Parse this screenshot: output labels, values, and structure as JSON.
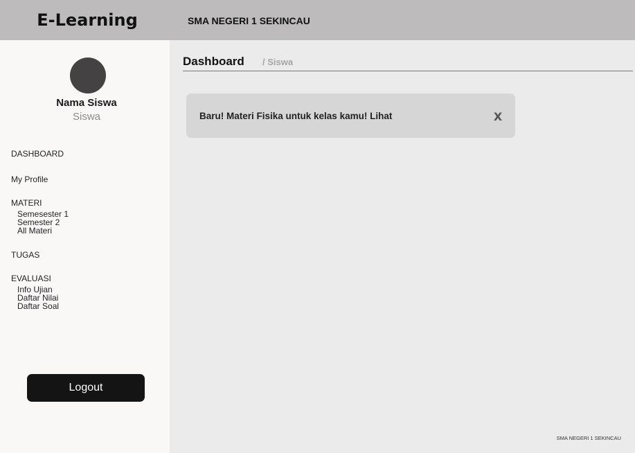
{
  "header": {
    "brand": "E-Learning",
    "school": "SMA NEGERI 1 SEKINCAU"
  },
  "sidebar": {
    "user_name": "Nama Siswa",
    "user_role": "Siswa",
    "nav": {
      "dashboard": "DASHBOARD",
      "profile": "My Profile",
      "materi": "MATERI",
      "materi_items": [
        "Semesester 1",
        "Semester 2",
        "All Materi"
      ],
      "tugas": "TUGAS",
      "evaluasi": "EVALUASI",
      "evaluasi_items": [
        "Info Ujian",
        "Daftar Nilai",
        "Daftar Soal"
      ]
    },
    "logout_label": "Logout"
  },
  "main": {
    "title": "Dashboard",
    "breadcrumb": "/ Siswa",
    "notification": {
      "text": "Baru! Materi Fisika untuk kelas kamu!  Lihat",
      "close_label": "X"
    },
    "footer": "SMA NEGERI 1 SEKINCAU"
  },
  "colors": {
    "header_bg": "#bdbbbb",
    "sidebar_bg": "#f9f8f7",
    "main_bg": "#ebebeb",
    "notice_bg": "#d6d6d6",
    "logout_bg": "#141414",
    "avatar": "#444242"
  }
}
